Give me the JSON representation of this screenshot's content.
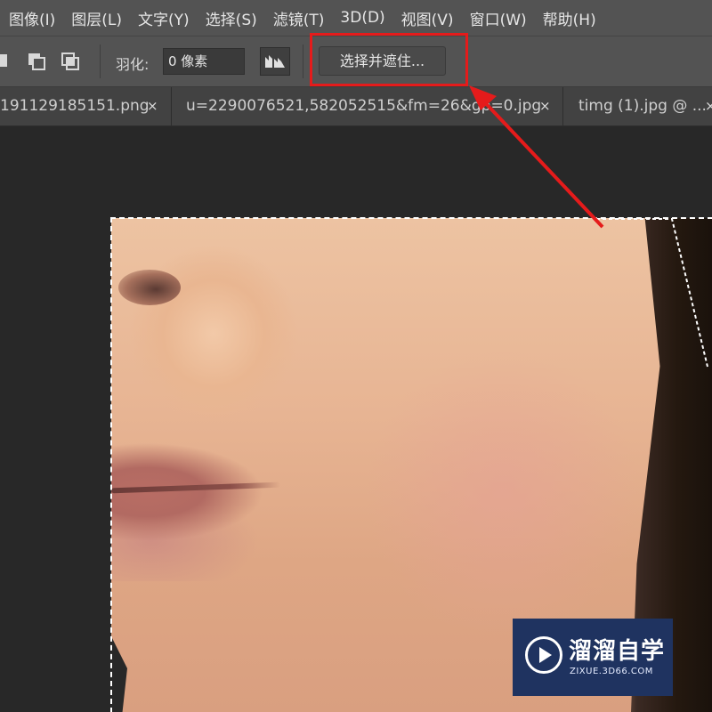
{
  "menu": {
    "items": [
      "图像(I)",
      "图层(L)",
      "文字(Y)",
      "选择(S)",
      "滤镜(T)",
      "3D(D)",
      "视图(V)",
      "窗口(W)",
      "帮助(H)"
    ]
  },
  "options": {
    "feather_label": "羽化:",
    "feather_value": "0 像素",
    "refine_button": "选择并遮住..."
  },
  "tabs": [
    {
      "label": "191129185151.png",
      "close": "×"
    },
    {
      "label": "u=2290076521,582052515&fm=26&gp=0.jpg",
      "close": "×"
    },
    {
      "label": "timg (1).jpg @ ...",
      "close": "×"
    }
  ],
  "watermark": {
    "title": "溜溜自学",
    "subtitle": "ZIXUE.3D66.COM"
  },
  "colors": {
    "menubar_bg": "#535353",
    "canvas_bg": "#282828",
    "highlight": "#e51b1b",
    "watermark_bg": "#1f3360"
  }
}
